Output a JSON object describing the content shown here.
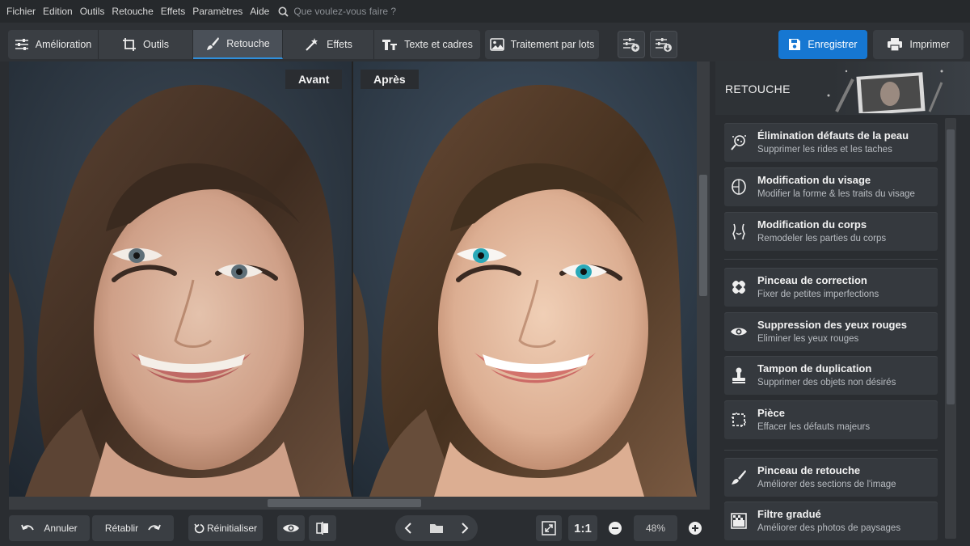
{
  "menu": {
    "items": [
      "Fichier",
      "Edition",
      "Outils",
      "Retouche",
      "Effets",
      "Paramètres",
      "Aide"
    ],
    "search_placeholder": "Que voulez-vous faire ?"
  },
  "toolbar": {
    "tabs": [
      {
        "label": "Amélioration",
        "icon": "sliders-icon"
      },
      {
        "label": "Outils",
        "icon": "crop-icon"
      },
      {
        "label": "Retouche",
        "icon": "brush-icon",
        "active": true
      },
      {
        "label": "Effets",
        "icon": "magic-wand-icon"
      },
      {
        "label": "Texte et cadres",
        "icon": "text-icon"
      }
    ],
    "batch_label": "Traitement par lots",
    "save_label": "Enregistrer",
    "print_label": "Imprimer"
  },
  "canvas": {
    "before_label": "Avant",
    "after_label": "Après"
  },
  "bottom": {
    "undo_label": "Annuler",
    "redo_label": "Rétablir",
    "reset_label": "Réinitialiser",
    "fit_label": "1:1",
    "zoom_value": "48%"
  },
  "panel": {
    "title": "RETOUCHE",
    "items": [
      {
        "title": "Élimination défauts de la peau",
        "subtitle": "Supprimer les rides et les taches",
        "icon": "skin-icon"
      },
      {
        "title": "Modification du visage",
        "subtitle": "Modifier la forme & les traits du visage",
        "icon": "face-icon"
      },
      {
        "title": "Modification du corps",
        "subtitle": "Remodeler les parties du corps",
        "icon": "body-icon"
      },
      {
        "title": "Pinceau de correction",
        "subtitle": "Fixer de petites imperfections",
        "icon": "bandage-icon"
      },
      {
        "title": "Suppression des yeux rouges",
        "subtitle": "Eliminer les yeux rouges",
        "icon": "eye-icon"
      },
      {
        "title": "Tampon de duplication",
        "subtitle": "Supprimer des objets non désirés",
        "icon": "stamp-icon"
      },
      {
        "title": "Pièce",
        "subtitle": "Effacer les défauts majeurs",
        "icon": "patch-icon"
      },
      {
        "title": "Pinceau de retouche",
        "subtitle": "Améliorer des sections de l'image",
        "icon": "brush-icon"
      },
      {
        "title": "Filtre gradué",
        "subtitle": "Améliorer des photos de paysages",
        "icon": "gradient-icon"
      }
    ]
  },
  "colors": {
    "accent": "#1677d2",
    "panel_bg": "#2a2d31",
    "item_bg": "#35393e",
    "eye_after": "#2aa9b8"
  }
}
